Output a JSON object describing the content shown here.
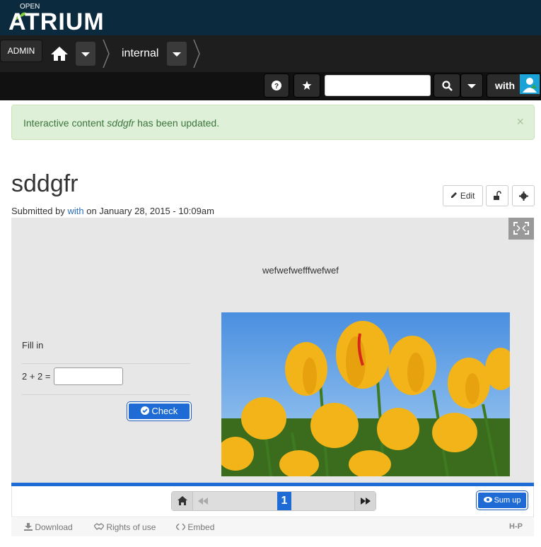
{
  "brand": {
    "open": "OPEN",
    "name": "ATRIUM"
  },
  "nav": {
    "admin_label": "ADMIN",
    "breadcrumb": "internal"
  },
  "toolbar": {
    "user_label": "with",
    "search_placeholder": ""
  },
  "alert": {
    "prefix": "Interactive content ",
    "item": "sddgfr",
    "suffix": " has been updated.",
    "close": "×"
  },
  "node": {
    "title": "sddgfr",
    "submitted_prefix": "Submitted by ",
    "author": "with",
    "submitted_suffix": " on January 28, 2015 - 10:09am",
    "edit_label": "Edit"
  },
  "h5p": {
    "slide_text": "wefwefwefffwefwef",
    "fill_title": "Fill in",
    "equation": "2 + 2 =",
    "answer_value": "",
    "check_label": "Check",
    "progress_fraction": 1.0,
    "current_slide": "1",
    "sumup_label": "Sum up"
  },
  "actions": {
    "download": "Download",
    "rights": "Rights of use",
    "embed": "Embed",
    "logo": "H-P"
  },
  "colors": {
    "brand_bg": "#0b2a3d",
    "accent": "#1f6bd6",
    "alert_bg": "#dff0d8",
    "link": "#2a6ebb"
  }
}
